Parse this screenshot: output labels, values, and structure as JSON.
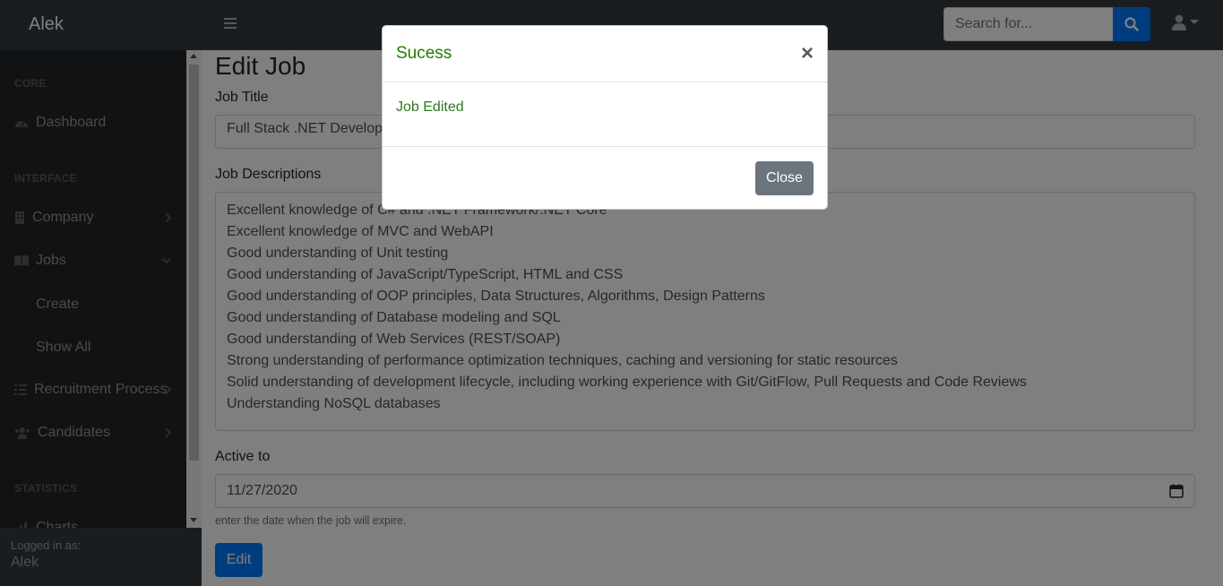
{
  "topnav": {
    "brand": "Alek",
    "search_placeholder": "Search for...",
    "search_icon": "search-icon",
    "user_icon": "user-icon"
  },
  "sidebar": {
    "headings": {
      "core": "CORE",
      "interface": "INTERFACE",
      "statistics": "STATISTICS"
    },
    "items": [
      {
        "label": "Dashboard",
        "icon": "dashboard-icon"
      },
      {
        "label": "Company",
        "icon": "building-icon"
      },
      {
        "label": "Jobs",
        "icon": "book-icon"
      },
      {
        "label": "Create"
      },
      {
        "label": "Show All"
      },
      {
        "label": "Recruitment Process",
        "icon": "list-icon"
      },
      {
        "label": "Candidates",
        "icon": "users-icon"
      },
      {
        "label": "Charts",
        "icon": "chart-icon"
      }
    ],
    "footer": {
      "label": "Logged in as:",
      "name": "Alek"
    }
  },
  "main": {
    "title": "Edit Job",
    "job_title_label": "Job Title",
    "job_title_value": "Full Stack .NET Developer",
    "descriptions_label": "Job Descriptions",
    "descriptions_value": "Excellent knowledge of C# and .NET Framework/.NET Core\nExcellent knowledge of MVC and WebAPI\nGood understanding of Unit testing\nGood understanding of JavaScript/TypeScript, HTML and CSS\nGood understanding of OOP principles, Data Structures, Algorithms, Design Patterns\nGood understanding of Database modeling and SQL\nGood understanding of Web Services (REST/SOAP)\nStrong understanding of performance optimization techniques, caching and versioning for static resources\nSolid understanding of development lifecycle, including working experience with Git/GitFlow, Pull Requests and Code Reviews\nUnderstanding NoSQL databases",
    "active_to_label": "Active to",
    "active_to_value": "11/27/2020",
    "active_to_help": "enter the date when the job will expire.",
    "edit_button": "Edit"
  },
  "modal": {
    "title": "Sucess",
    "close_x": "×",
    "body": "Job Edited",
    "close_button": "Close"
  },
  "colors": {
    "accent": "#007bff",
    "success_text": "#1e7e00",
    "sidebar_bg": "#212529",
    "topnav_bg": "#343a40"
  }
}
